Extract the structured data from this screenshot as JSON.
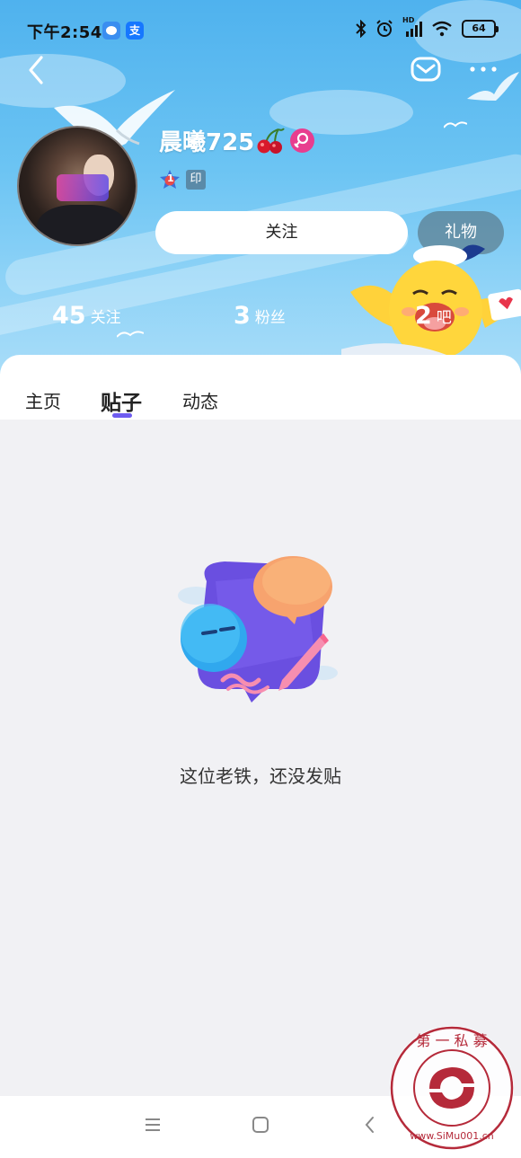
{
  "status_bar": {
    "time": "下午2:54",
    "app_badge_2": "支",
    "battery": "64",
    "hd_label": "HD"
  },
  "profile": {
    "username": "晨曦725",
    "seal_badge": "印",
    "level": "1",
    "follow_button": "关注",
    "gift_button": "礼物"
  },
  "stats": [
    {
      "value": "45",
      "label": "关注"
    },
    {
      "value": "3",
      "label": "粉丝"
    },
    {
      "value": "2",
      "label": "吧"
    }
  ],
  "tabs": [
    {
      "label": "主页"
    },
    {
      "label": "贴子"
    },
    {
      "label": "动态"
    }
  ],
  "active_tab": "贴子",
  "empty_state": {
    "message": "这位老铁，还没发贴"
  },
  "watermark": {
    "ring_text": "第 一 私 募",
    "url_text": "www.SiMu001.cn"
  },
  "colors": {
    "header_top": "#4fb2ee",
    "accent": "#6e5cf0",
    "gender_badge": "#e83d8f",
    "watermark": "#b52a3a"
  }
}
